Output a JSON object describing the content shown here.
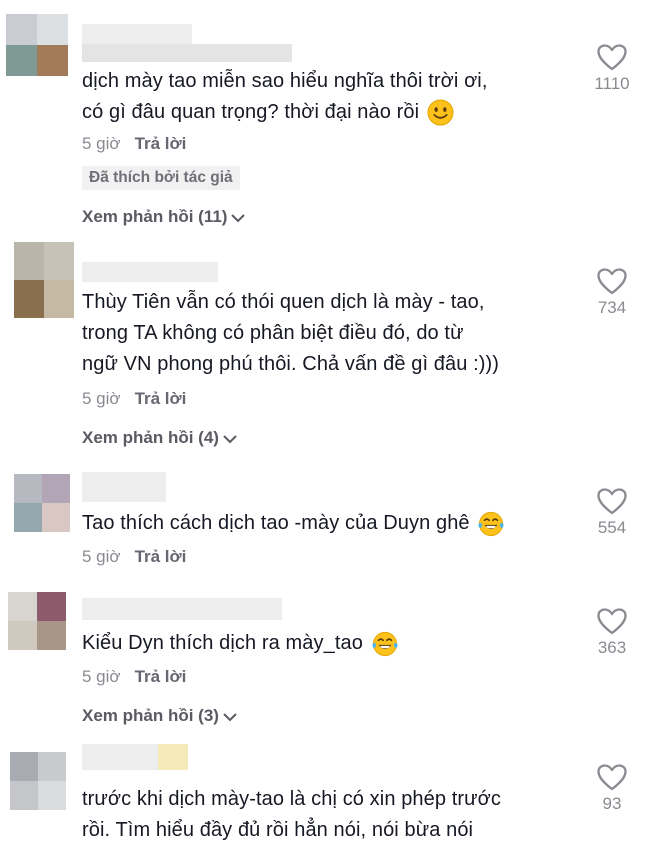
{
  "comments": [
    {
      "text_lines": [
        "dịch mày tao miễn sao hiểu nghĩa thôi trời ơi,",
        "có gì đâu quan trọng? thời đại nào rồi"
      ],
      "emoji": "slightly-smiling-face",
      "time": "5 giờ",
      "reply": "Trả lời",
      "creator_tag": "Đã thích bởi tác giả",
      "view_replies": "Xem phản hồi (11)",
      "likes": "1110",
      "avatar_colors": [
        "#c9cdd3",
        "#dde0e2",
        "#7f9a95",
        "#a27c58"
      ]
    },
    {
      "text_lines": [
        "Thùy Tiên vẫn có thói quen dịch là mày - tao,",
        "trong TA không có phân biệt điều đó, do từ",
        "ngữ VN phong phú thôi. Chả vấn đề gì đâu :)))"
      ],
      "time": "5 giờ",
      "reply": "Trả lời",
      "view_replies": "Xem phản hồi (4)",
      "likes": "734",
      "avatar_colors": [
        "#b9b5ab",
        "#c7c2b8",
        "#8a6f4f",
        "#c6b9a3"
      ]
    },
    {
      "text_lines": [
        "Tao thích cách dịch tao -mày của Duyn ghê"
      ],
      "emoji": "face-with-tears-of-joy",
      "time": "5 giờ",
      "reply": "Trả lời",
      "likes": "554",
      "avatar_colors": [
        "#b6b9c0",
        "#b1a5b6",
        "#93a7ad",
        "#d8c7c3"
      ]
    },
    {
      "text_lines": [
        "Kiểu Dyn thích dịch ra mày_tao"
      ],
      "emoji": "face-with-tears-of-joy",
      "time": "5 giờ",
      "reply": "Trả lời",
      "view_replies": "Xem phản hồi (3)",
      "likes": "363",
      "avatar_colors": [
        "#d8d4cf",
        "#8c5a6b",
        "#cfc8bf",
        "#a89689"
      ]
    },
    {
      "text_lines": [
        "trước khi dịch mày-tao là chị có xin phép trước",
        "rồi. Tìm hiểu đầy đủ rồi hẳn nói, nói bừa nói"
      ],
      "likes": "93",
      "avatar_colors": [
        "#a8abb1",
        "#c8cacd",
        "#c4c6c9",
        "#dadbdd"
      ]
    }
  ],
  "colors": {
    "text": "#161823",
    "muted": "#8a8b91",
    "tag_bg": "#f1f1f2"
  }
}
